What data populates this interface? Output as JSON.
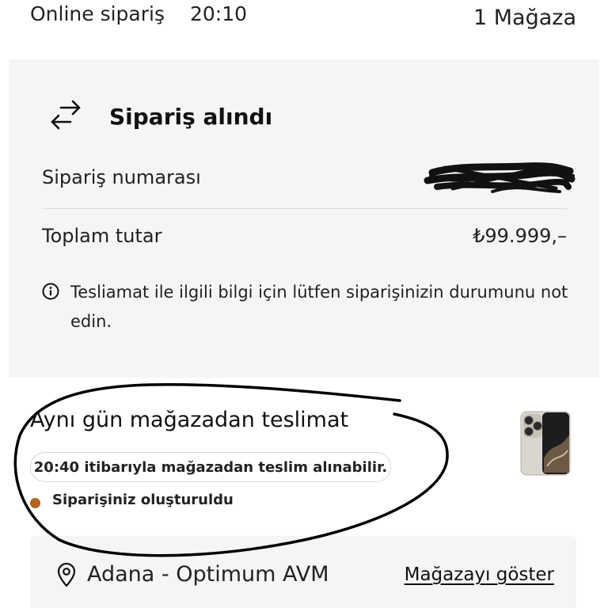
{
  "topbar": {
    "order_kind": "Online sipariş",
    "time": "20:10",
    "store_count": "1 Mağaza"
  },
  "summary": {
    "title": "Sipariş alındı",
    "order_number_label": "Sipariş numarası",
    "total_label": "Toplam tutar",
    "total_value": "₺99.999,–",
    "info_text": "Tesliamat ile ilgili bilgi için lütfen siparişinizin durumunu not edin."
  },
  "delivery": {
    "title": "Aynı gün mağazadan teslimat",
    "pickup_note": "20:40 itibarıyla mağazadan teslim alınabilir.",
    "status": "Siparişiniz oluşturuldu",
    "status_color": "#b5651d"
  },
  "store": {
    "name": "Adana - Optimum AVM",
    "show_link": "Mağazayı göster"
  },
  "icons": {
    "swap": "swap-arrows-icon",
    "info": "info-icon",
    "pin": "location-pin-icon"
  }
}
